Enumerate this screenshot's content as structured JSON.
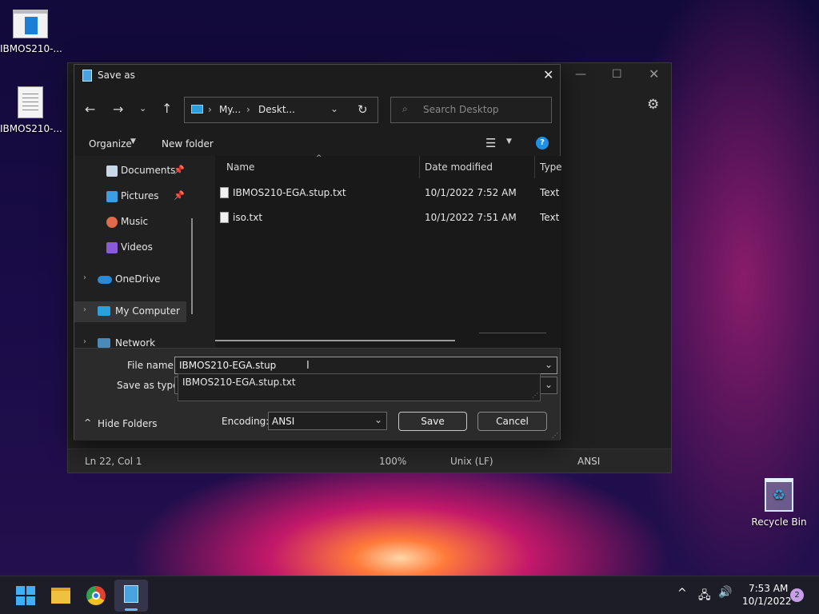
{
  "desktop": {
    "icons": [
      {
        "label": "IBMOS210-...",
        "icon": "window-app-icon"
      },
      {
        "label": "IBMOS210-...",
        "icon": "text-document-icon"
      }
    ],
    "recycle_bin": {
      "label": "Recycle Bin",
      "icon": "recycle-bin-icon"
    }
  },
  "notepad": {
    "status": {
      "position": "Ln 22, Col 1",
      "zoom": "100%",
      "line_ending": "Unix (LF)",
      "encoding": "ANSI"
    }
  },
  "dialog": {
    "title": "Save as",
    "address": {
      "segments": [
        "My...",
        "Deskt..."
      ]
    },
    "search_placeholder": "Search Desktop",
    "commands": {
      "organize": "Organize",
      "new_folder": "New folder"
    },
    "sidebar": [
      {
        "label": "Documents",
        "icon": "documents-icon",
        "pinned": true
      },
      {
        "label": "Pictures",
        "icon": "pictures-icon",
        "pinned": true
      },
      {
        "label": "Music",
        "icon": "music-icon"
      },
      {
        "label": "Videos",
        "icon": "videos-icon"
      },
      {
        "label": "OneDrive",
        "icon": "onedrive-icon"
      },
      {
        "label": "My Computer",
        "icon": "computer-icon",
        "selected": true
      },
      {
        "label": "Network",
        "icon": "network-icon"
      }
    ],
    "columns": {
      "name": "Name",
      "date": "Date modified",
      "type": "Type"
    },
    "files": [
      {
        "name": "IBMOS210-EGA.stup.txt",
        "date": "10/1/2022 7:52 AM",
        "type": "Text D"
      },
      {
        "name": "iso.txt",
        "date": "10/1/2022 7:51 AM",
        "type": "Text D"
      }
    ],
    "file_name_label": "File name:",
    "file_name_value": "IBMOS210-EGA.stup",
    "autocomplete_suggestion": "IBMOS210-EGA.stup.txt",
    "save_as_type_label": "Save as type:",
    "hide_folders": "Hide Folders",
    "encoding_label": "Encoding:",
    "encoding_value": "ANSI",
    "save": "Save",
    "cancel": "Cancel"
  },
  "taskbar": {
    "time": "7:53 AM",
    "date": "10/1/2022",
    "notifications": "2"
  },
  "colors": {
    "accent": "#1c7fd6",
    "help": "#1e90e8"
  }
}
